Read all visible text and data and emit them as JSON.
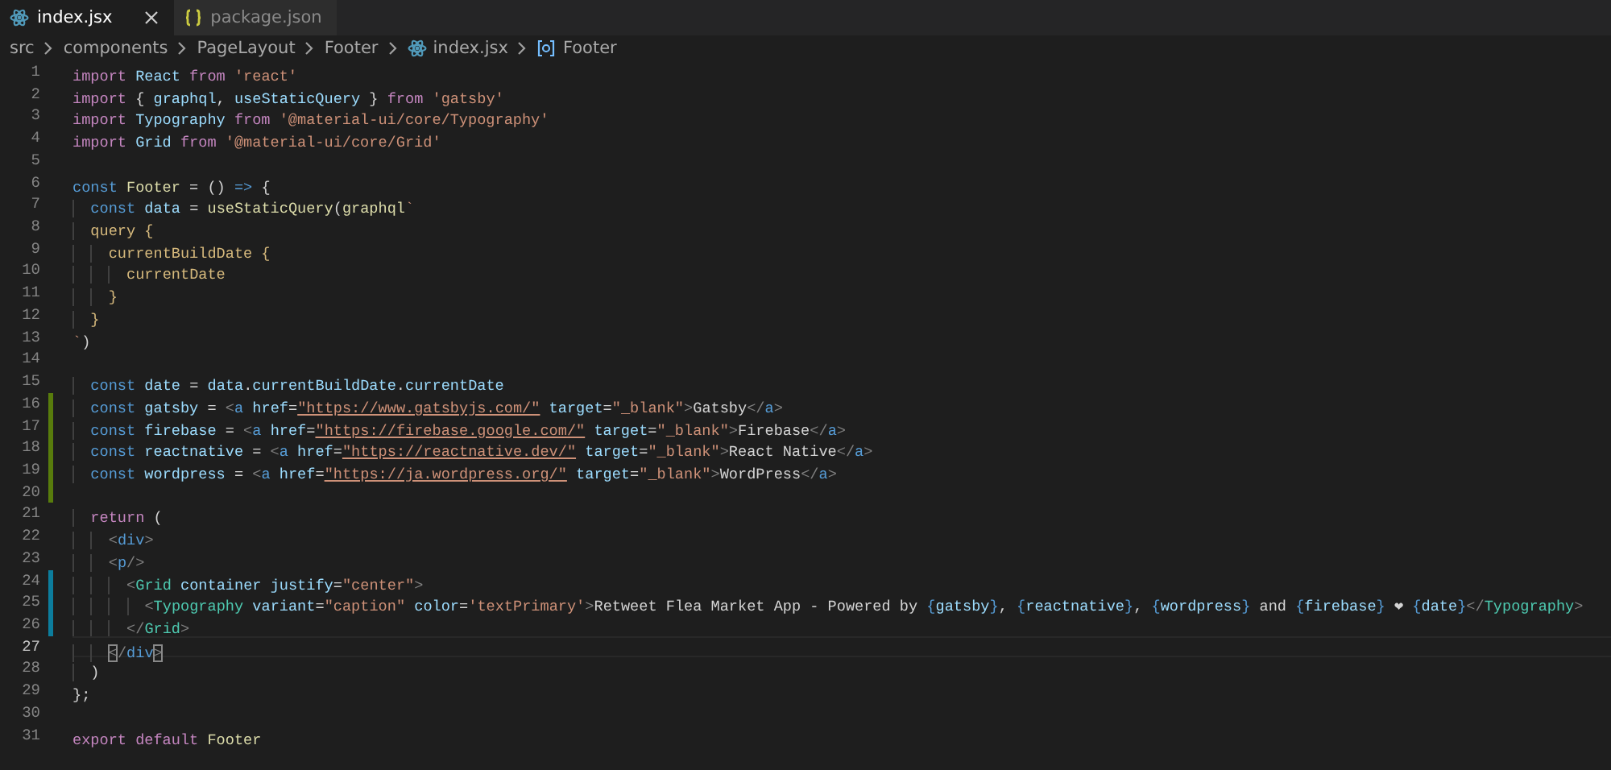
{
  "tabs": [
    {
      "label": "index.jsx",
      "kind": "jsx",
      "selected": true
    },
    {
      "label": "package.json",
      "kind": "json",
      "selected": false
    }
  ],
  "breadcrumb": [
    {
      "label": "src",
      "kind": "folder"
    },
    {
      "label": "components",
      "kind": "folder"
    },
    {
      "label": "PageLayout",
      "kind": "folder"
    },
    {
      "label": "Footer",
      "kind": "folder"
    },
    {
      "label": "index.jsx",
      "kind": "jsx"
    },
    {
      "label": "Footer",
      "kind": "symbol"
    }
  ],
  "lines": [
    {
      "n": "1",
      "current": false,
      "tokens": [
        {
          "kind": "kw",
          "text": "import"
        },
        {
          "kind": "va",
          "text": " React"
        },
        {
          "kind": "kw",
          "text": " from"
        },
        {
          "kind": "str",
          "text": " 'react'"
        }
      ]
    },
    {
      "n": "2",
      "current": false,
      "tokens": [
        {
          "kind": "kw",
          "text": "import"
        },
        {
          "kind": "pu",
          "text": " {"
        },
        {
          "kind": "va",
          "text": " graphql"
        },
        {
          "kind": "pu",
          "text": ","
        },
        {
          "kind": "va",
          "text": " useStaticQuery"
        },
        {
          "kind": "pu",
          "text": " }"
        },
        {
          "kind": "kw",
          "text": " from"
        },
        {
          "kind": "str",
          "text": " 'gatsby'"
        }
      ]
    },
    {
      "n": "3",
      "current": false,
      "tokens": [
        {
          "kind": "kw",
          "text": "import"
        },
        {
          "kind": "va",
          "text": " Typography"
        },
        {
          "kind": "kw",
          "text": " from"
        },
        {
          "kind": "str",
          "text": " '@material-ui/core/Typography'"
        }
      ]
    },
    {
      "n": "4",
      "current": false,
      "tokens": [
        {
          "kind": "kw",
          "text": "import"
        },
        {
          "kind": "va",
          "text": " Grid"
        },
        {
          "kind": "kw",
          "text": " from"
        },
        {
          "kind": "str",
          "text": " '@material-ui/core/Grid'"
        }
      ]
    },
    {
      "n": "5",
      "current": false
    },
    {
      "n": "6",
      "current": false,
      "tokens": [
        {
          "kind": "st",
          "text": "const"
        },
        {
          "kind": "fn",
          "text": " Footer"
        },
        {
          "kind": "pu",
          "text": " = ()"
        },
        {
          "kind": "st",
          "text": " =>"
        },
        {
          "kind": "pu",
          "text": " {"
        }
      ]
    },
    {
      "n": "7",
      "current": false,
      "tokens": [
        {
          "kind": "st",
          "text": "  const"
        },
        {
          "kind": "va",
          "text": " data"
        },
        {
          "kind": "pu",
          "text": " ="
        },
        {
          "kind": "fn",
          "text": " useStaticQuery"
        },
        {
          "kind": "pu",
          "text": "("
        },
        {
          "kind": "fn",
          "text": "graphql"
        },
        {
          "kind": "str",
          "text": "`"
        }
      ]
    },
    {
      "n": "8",
      "current": false,
      "tokens": [
        {
          "kind": "gq",
          "text": "  query {"
        }
      ]
    },
    {
      "n": "9",
      "current": false,
      "tokens": [
        {
          "kind": "gq",
          "text": "    currentBuildDate {"
        }
      ]
    },
    {
      "n": "10",
      "current": false,
      "tokens": [
        {
          "kind": "gq",
          "text": "      currentDate"
        }
      ]
    },
    {
      "n": "11",
      "current": false,
      "tokens": [
        {
          "kind": "gq",
          "text": "    }"
        }
      ]
    },
    {
      "n": "12",
      "current": false,
      "tokens": [
        {
          "kind": "gq",
          "text": "  }"
        }
      ]
    },
    {
      "n": "13",
      "current": false,
      "tokens": [
        {
          "kind": "str",
          "text": "`"
        },
        {
          "kind": "pu",
          "text": ")"
        }
      ]
    },
    {
      "n": "14",
      "current": false
    },
    {
      "n": "15",
      "current": false,
      "tokens": [
        {
          "kind": "st",
          "text": "  const"
        },
        {
          "kind": "va",
          "text": " date"
        },
        {
          "kind": "pu",
          "text": " ="
        },
        {
          "kind": "va",
          "text": " data"
        },
        {
          "kind": "pu",
          "text": "."
        },
        {
          "kind": "va",
          "text": "currentBuildDate"
        },
        {
          "kind": "pu",
          "text": "."
        },
        {
          "kind": "va",
          "text": "currentDate"
        }
      ]
    },
    {
      "n": "16",
      "added": true,
      "current": false,
      "tokens": [
        {
          "kind": "st",
          "text": "  const"
        },
        {
          "kind": "va",
          "text": " gatsby"
        },
        {
          "kind": "pu",
          "text": " ="
        },
        {
          "kind": "br",
          "text": " <"
        },
        {
          "kind": "tg",
          "text": "a"
        },
        {
          "kind": "at",
          "text": " href"
        },
        {
          "kind": "pu",
          "text": "="
        },
        {
          "kind": "url",
          "text": "\"https://www.gatsbyjs.com/\""
        },
        {
          "kind": "at",
          "text": " target"
        },
        {
          "kind": "pu",
          "text": "="
        },
        {
          "kind": "str",
          "text": "\"_blank\""
        },
        {
          "kind": "br",
          "text": ">"
        },
        {
          "kind": "tx",
          "text": "Gatsby"
        },
        {
          "kind": "br",
          "text": "</"
        },
        {
          "kind": "tg",
          "text": "a"
        },
        {
          "kind": "br",
          "text": ">"
        }
      ]
    },
    {
      "n": "17",
      "added": true,
      "current": false,
      "tokens": [
        {
          "kind": "st",
          "text": "  const"
        },
        {
          "kind": "va",
          "text": " firebase"
        },
        {
          "kind": "pu",
          "text": " ="
        },
        {
          "kind": "br",
          "text": " <"
        },
        {
          "kind": "tg",
          "text": "a"
        },
        {
          "kind": "at",
          "text": " href"
        },
        {
          "kind": "pu",
          "text": "="
        },
        {
          "kind": "url",
          "text": "\"https://firebase.google.com/\""
        },
        {
          "kind": "at",
          "text": " target"
        },
        {
          "kind": "pu",
          "text": "="
        },
        {
          "kind": "str",
          "text": "\"_blank\""
        },
        {
          "kind": "br",
          "text": ">"
        },
        {
          "kind": "tx",
          "text": "Firebase"
        },
        {
          "kind": "br",
          "text": "</"
        },
        {
          "kind": "tg",
          "text": "a"
        },
        {
          "kind": "br",
          "text": ">"
        }
      ]
    },
    {
      "n": "18",
      "added": true,
      "current": false,
      "tokens": [
        {
          "kind": "st",
          "text": "  const"
        },
        {
          "kind": "va",
          "text": " reactnative"
        },
        {
          "kind": "pu",
          "text": " ="
        },
        {
          "kind": "br",
          "text": " <"
        },
        {
          "kind": "tg",
          "text": "a"
        },
        {
          "kind": "at",
          "text": " href"
        },
        {
          "kind": "pu",
          "text": "="
        },
        {
          "kind": "url",
          "text": "\"https://reactnative.dev/\""
        },
        {
          "kind": "at",
          "text": " target"
        },
        {
          "kind": "pu",
          "text": "="
        },
        {
          "kind": "str",
          "text": "\"_blank\""
        },
        {
          "kind": "br",
          "text": ">"
        },
        {
          "kind": "tx",
          "text": "React Native"
        },
        {
          "kind": "br",
          "text": "</"
        },
        {
          "kind": "tg",
          "text": "a"
        },
        {
          "kind": "br",
          "text": ">"
        }
      ]
    },
    {
      "n": "19",
      "added": true,
      "current": false,
      "tokens": [
        {
          "kind": "st",
          "text": "  const"
        },
        {
          "kind": "va",
          "text": " wordpress"
        },
        {
          "kind": "pu",
          "text": " ="
        },
        {
          "kind": "br",
          "text": " <"
        },
        {
          "kind": "tg",
          "text": "a"
        },
        {
          "kind": "at",
          "text": " href"
        },
        {
          "kind": "pu",
          "text": "="
        },
        {
          "kind": "url",
          "text": "\"https://ja.wordpress.org/\""
        },
        {
          "kind": "at",
          "text": " target"
        },
        {
          "kind": "pu",
          "text": "="
        },
        {
          "kind": "str",
          "text": "\"_blank\""
        },
        {
          "kind": "br",
          "text": ">"
        },
        {
          "kind": "tx",
          "text": "WordPress"
        },
        {
          "kind": "br",
          "text": "</"
        },
        {
          "kind": "tg",
          "text": "a"
        },
        {
          "kind": "br",
          "text": ">"
        }
      ]
    },
    {
      "n": "20",
      "added": true,
      "current": false
    },
    {
      "n": "21",
      "current": false,
      "tokens": [
        {
          "kind": "kw",
          "text": "  return"
        },
        {
          "kind": "pu",
          "text": " ("
        }
      ]
    },
    {
      "n": "22",
      "current": false,
      "tokens": [
        {
          "kind": "br",
          "text": "    <"
        },
        {
          "kind": "tg",
          "text": "div"
        },
        {
          "kind": "br",
          "text": ">"
        }
      ]
    },
    {
      "n": "23",
      "current": false,
      "tokens": [
        {
          "kind": "br",
          "text": "    <"
        },
        {
          "kind": "tg",
          "text": "p"
        },
        {
          "kind": "br",
          "text": "/>"
        }
      ]
    },
    {
      "n": "24",
      "modified": true,
      "current": false,
      "tokens": [
        {
          "kind": "br",
          "text": "      <"
        },
        {
          "kind": "cm",
          "text": "Grid"
        },
        {
          "kind": "at",
          "text": " container"
        },
        {
          "kind": "at",
          "text": " justify"
        },
        {
          "kind": "pu",
          "text": "="
        },
        {
          "kind": "str",
          "text": "\"center\""
        },
        {
          "kind": "br",
          "text": ">"
        }
      ]
    },
    {
      "n": "25",
      "modified": true,
      "current": false,
      "tokens": [
        {
          "kind": "br",
          "text": "        <"
        },
        {
          "kind": "cm",
          "text": "Typography"
        },
        {
          "kind": "at",
          "text": " variant"
        },
        {
          "kind": "pu",
          "text": "="
        },
        {
          "kind": "str",
          "text": "\"caption\""
        },
        {
          "kind": "at",
          "text": " color"
        },
        {
          "kind": "pu",
          "text": "="
        },
        {
          "kind": "str",
          "text": "'textPrimary'"
        },
        {
          "kind": "br",
          "text": ">"
        },
        {
          "kind": "tx",
          "text": "Retweet Flea Market App - Powered by"
        },
        {
          "kind": "ex",
          "text": " {"
        },
        {
          "kind": "va",
          "text": "gatsby"
        },
        {
          "kind": "ex",
          "text": "}"
        },
        {
          "kind": "tx",
          "text": ","
        },
        {
          "kind": "ex",
          "text": " {"
        },
        {
          "kind": "va",
          "text": "reactnative"
        },
        {
          "kind": "ex",
          "text": "}"
        },
        {
          "kind": "tx",
          "text": ","
        },
        {
          "kind": "ex",
          "text": " {"
        },
        {
          "kind": "va",
          "text": "wordpress"
        },
        {
          "kind": "ex",
          "text": "}"
        },
        {
          "kind": "tx",
          "text": " and"
        },
        {
          "kind": "ex",
          "text": " {"
        },
        {
          "kind": "va",
          "text": "firebase"
        },
        {
          "kind": "ex",
          "text": "}"
        },
        {
          "kind": "tx",
          "text": " ❤"
        },
        {
          "kind": "ex",
          "text": " {"
        },
        {
          "kind": "va",
          "text": "date"
        },
        {
          "kind": "ex",
          "text": "}"
        },
        {
          "kind": "br",
          "text": "</"
        },
        {
          "kind": "cm",
          "text": "Typography"
        },
        {
          "kind": "br",
          "text": ">"
        }
      ]
    },
    {
      "n": "26",
      "modified": true,
      "current": false,
      "tokens": [
        {
          "kind": "br",
          "text": "      </"
        },
        {
          "kind": "cm",
          "text": "Grid"
        },
        {
          "kind": "br",
          "text": ">"
        }
      ]
    },
    {
      "n": "27",
      "current": true,
      "tokens": [
        {
          "kind": "bm",
          "text": "    <"
        },
        {
          "kind": "br",
          "text": "/"
        },
        {
          "kind": "tg",
          "text": "div"
        },
        {
          "kind": "bm",
          "text": ">"
        }
      ]
    },
    {
      "n": "28",
      "current": false,
      "tokens": [
        {
          "kind": "pu",
          "text": "  )"
        }
      ]
    },
    {
      "n": "29",
      "current": false,
      "tokens": [
        {
          "kind": "pu",
          "text": "};"
        }
      ]
    },
    {
      "n": "30",
      "current": false
    },
    {
      "n": "31",
      "current": false,
      "tokens": [
        {
          "kind": "kw",
          "text": "export"
        },
        {
          "kind": "kw",
          "text": " default"
        },
        {
          "kind": "fn",
          "text": " Footer"
        }
      ]
    }
  ]
}
